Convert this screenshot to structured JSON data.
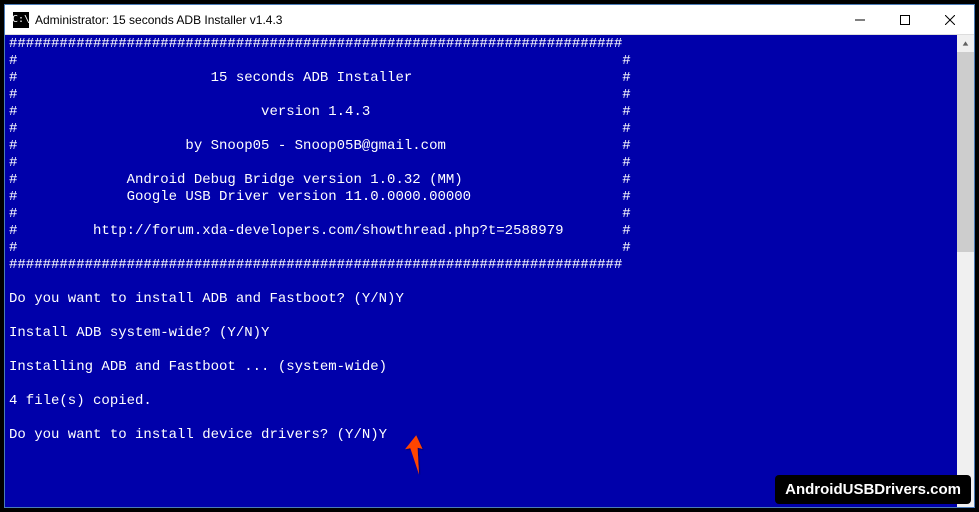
{
  "window": {
    "title": "Administrator:  15 seconds ADB Installer v1.4.3"
  },
  "banner": {
    "border_top": "#########################################################################",
    "line_empty": "#                                                                        #",
    "title": "#                       15 seconds ADB Installer                         #",
    "version": "#                             version 1.4.3                              #",
    "author": "#                    by Snoop05 - Snoop05B@gmail.com                     #",
    "adb_version": "#             Android Debug Bridge version 1.0.32 (MM)                   #",
    "usb_version": "#             Google USB Driver version 11.0.0000.00000                  #",
    "forum_url": "#         http://forum.xda-developers.com/showthread.php?t=2588979       #",
    "border_bottom": "#########################################################################"
  },
  "prompts": {
    "q1": "Do you want to install ADB and Fastboot? (Y/N)Y",
    "q2": "Install ADB system-wide? (Y/N)Y",
    "status": "Installing ADB and Fastboot ... (system-wide)",
    "files_copied": "4 file(s) copied.",
    "q3": "Do you want to install device drivers? (Y/N)Y"
  },
  "watermark": "AndroidUSBDrivers.com"
}
